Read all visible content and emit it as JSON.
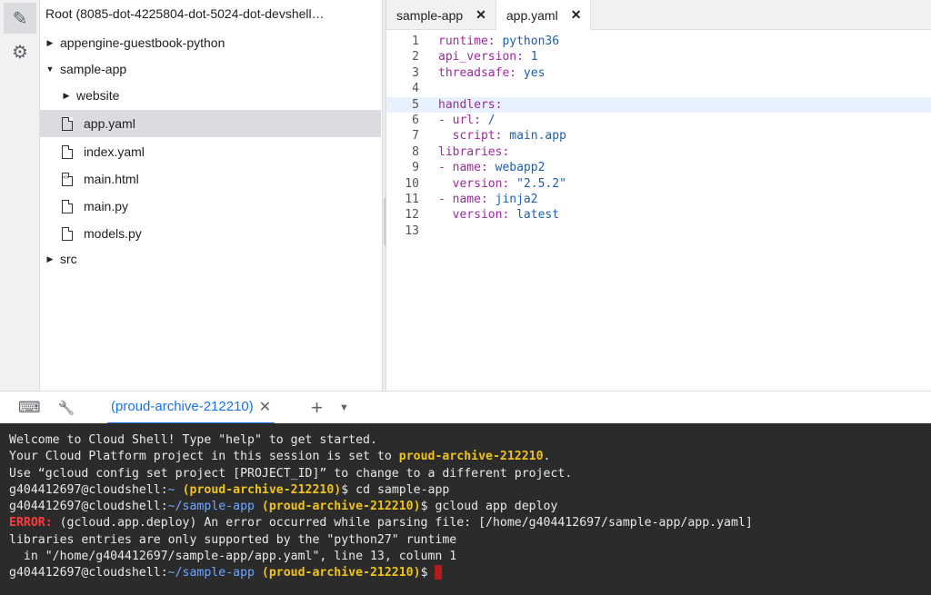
{
  "activity": {
    "items": [
      {
        "icon": "pencil-icon",
        "glyph": "✎"
      },
      {
        "icon": "gear-icon",
        "glyph": "⚙"
      }
    ]
  },
  "tree": {
    "root": "Root (8085-dot-4225804-dot-5024-dot-devshell…",
    "items": [
      {
        "label": "appengine-guestbook-python",
        "type": "folder",
        "expanded": false
      },
      {
        "label": "sample-app",
        "type": "folder",
        "expanded": true
      },
      {
        "label": "website",
        "type": "folder",
        "expanded": false
      },
      {
        "label": "app.yaml",
        "type": "file"
      },
      {
        "label": "index.yaml",
        "type": "file"
      },
      {
        "label": "main.html",
        "type": "html"
      },
      {
        "label": "main.py",
        "type": "file"
      },
      {
        "label": "models.py",
        "type": "file"
      },
      {
        "label": "src",
        "type": "folder",
        "expanded": false
      }
    ]
  },
  "editor": {
    "tabs": [
      {
        "label": "sample-app",
        "close": "✕"
      },
      {
        "label": "app.yaml",
        "close": "✕"
      }
    ],
    "lines": [
      {
        "n": "1",
        "key": "runtime:",
        "val": " python36"
      },
      {
        "n": "2",
        "key": "api_version:",
        "val": " 1"
      },
      {
        "n": "3",
        "key": "threadsafe:",
        "val": " yes"
      },
      {
        "n": "4",
        "key": "",
        "val": ""
      },
      {
        "n": "5",
        "key": "handlers:",
        "val": ""
      },
      {
        "n": "6",
        "key": "- url:",
        "val": " /"
      },
      {
        "n": "7",
        "key": "  script:",
        "val": " main.app"
      },
      {
        "n": "8",
        "key": "libraries:",
        "val": ""
      },
      {
        "n": "9",
        "key": "- name:",
        "val": " webapp2"
      },
      {
        "n": "10",
        "key": "  version:",
        "val": " \"2.5.2\""
      },
      {
        "n": "11",
        "key": "- name:",
        "val": " jinja2"
      },
      {
        "n": "12",
        "key": "  version:",
        "val": " latest"
      },
      {
        "n": "13",
        "key": "",
        "val": ""
      }
    ]
  },
  "terminal_bar": {
    "keyboard_glyph": "⌨",
    "wrench_glyph": "🔧",
    "tab_label": "(proud-archive-212210)",
    "tab_close": "✕",
    "plus": "+",
    "dropdown": "▼"
  },
  "terminal": {
    "welcome": "Welcome to Cloud Shell! Type \"help\" to get started.",
    "project_prefix": "Your Cloud Platform project in this session is set to ",
    "project_id": "proud-archive-212210",
    "project_suffix": ".",
    "use_line": "Use “gcloud config set project [PROJECT_ID]” to change to a different project.",
    "prompt_user": "g404412697@cloudshell:",
    "home": "~",
    "project_tag": " (proud-archive-212210)",
    "cmd1": "$ cd sample-app",
    "path2": "~/sample-app",
    "cmd2": "$ gcloud app deploy",
    "error_label": "ERROR:",
    "error_msg": " (gcloud.app.deploy) An error occurred while parsing file: [/home/g404412697/sample-app/app.yaml]",
    "error_line2": "libraries entries are only supported by the \"python27\" runtime",
    "error_line3": "  in \"/home/g404412697/sample-app/app.yaml\", line 13, column 1",
    "cmd3": "$ "
  },
  "colors": {
    "accent": "#1a73e8",
    "terminal_bg": "#2b2b2b",
    "project_yellow": "#f0c31a",
    "error_red": "#ff3b3b"
  }
}
